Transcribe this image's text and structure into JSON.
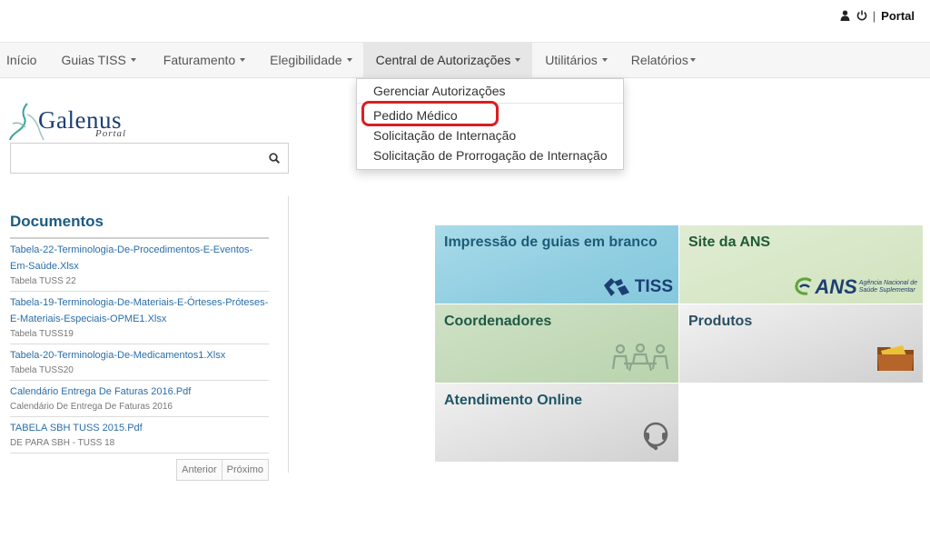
{
  "user_bar": {
    "user_icon": "user-icon",
    "power_icon": "power-icon",
    "separator": "|",
    "portal_label": "Portal"
  },
  "nav": {
    "items": [
      {
        "label": "Início",
        "has_caret": false
      },
      {
        "label": "Guias TISS",
        "has_caret": true
      },
      {
        "label": "Faturamento",
        "has_caret": true
      },
      {
        "label": "Elegibilidade",
        "has_caret": true
      },
      {
        "label": "Central de Autorizações",
        "has_caret": true,
        "active": true
      },
      {
        "label": "Utilitários",
        "has_caret": true
      },
      {
        "label": "Relatórios",
        "has_caret": true
      }
    ]
  },
  "dropdown": {
    "items": [
      {
        "label": "Gerenciar Autorizações"
      },
      {
        "label": "Pedido Médico",
        "highlighted": true
      },
      {
        "label": "Solicitação de Internação"
      },
      {
        "label": "Solicitação de Prorrogação de Internação"
      }
    ],
    "highlight_color": "#d81e24"
  },
  "logo": {
    "name": "Galenus",
    "subtitle": "Portal"
  },
  "search": {
    "value": "",
    "placeholder": "",
    "icon": "search-icon"
  },
  "documents": {
    "title": "Documentos",
    "items": [
      {
        "link": "Tabela-22-Terminologia-De-Procedimentos-E-Eventos-Em-Saúde.Xlsx",
        "desc": "Tabela TUSS 22"
      },
      {
        "link": "Tabela-19-Terminologia-De-Materiais-E-Órteses-Próteses-E-Materiais-Especiais-OPME1.Xlsx",
        "desc": "Tabela TUSS19"
      },
      {
        "link": "Tabela-20-Terminologia-De-Medicamentos1.Xlsx",
        "desc": "Tabela TUSS20"
      },
      {
        "link": "Calendário Entrega De Faturas 2016.Pdf",
        "desc": "Calendário De Entrega De Faturas 2016"
      },
      {
        "link": "TABELA SBH TUSS 2015.Pdf",
        "desc": "DE PARA SBH - TUSS 18"
      }
    ],
    "pager": {
      "prev": "Anterior",
      "next": "Próximo"
    }
  },
  "tiles": [
    {
      "title": "Impressão de guias em branco",
      "icon": "tiss-logo-icon",
      "icon_text": "TISS"
    },
    {
      "title": "Site da ANS",
      "icon": "ans-logo-icon",
      "icon_text": "ANS",
      "icon_subtext_1": "Agência Nacional de",
      "icon_subtext_2": "Saúde Suplementar"
    },
    {
      "title": "Coordenadores",
      "icon": "meeting-icon"
    },
    {
      "title": "Produtos",
      "icon": "folder-icon"
    },
    {
      "title": "Atendimento Online",
      "icon": "headset-icon"
    }
  ],
  "colors": {
    "link": "#2a6ea8",
    "heading": "#1b5b83",
    "tile_tiss": "#8fcde1",
    "tile_ans": "#d1e3be",
    "tile_coord": "#b9d3ad",
    "tile_gray": "#cfcfcf"
  }
}
